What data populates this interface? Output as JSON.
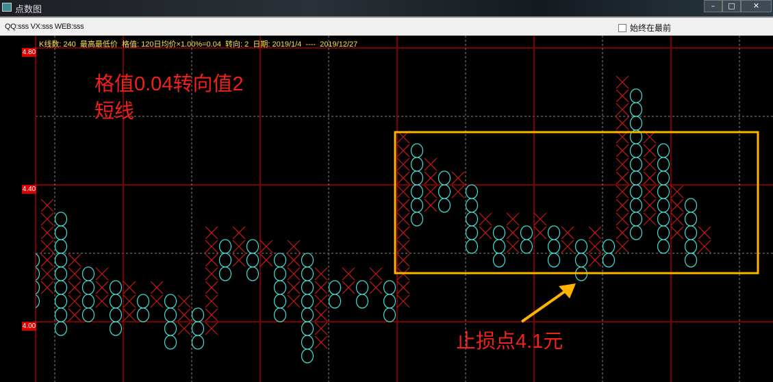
{
  "window": {
    "title": "点数图",
    "minimize": "–",
    "maximize": "□",
    "close": "✕"
  },
  "toolbar": {
    "contact": "QQ:sss VX:sss WEB:sss",
    "always_on_top_label": "始终在最前",
    "always_on_top_checked": false
  },
  "info_line": "K线数: 240  最高最低价  格值: 120日均价×1.00%=0.04  转向: 2  日期: 2019/1/4  ----  2019/12/27",
  "annotations": {
    "title_line1": "格值0.04转向值2",
    "title_line2": "短线",
    "stop_loss": "止损点4.1元"
  },
  "colors": {
    "x_mark": "#d01818",
    "o_mark": "#40e0d8",
    "grid_major": "#a00000",
    "grid_minor": "#888888",
    "highlight_box": "#ffb400",
    "annotation": "#f0201a"
  },
  "chart_data": {
    "type": "point-and-figure",
    "box_size": 0.04,
    "reversal": 2,
    "ylim": [
      3.84,
      4.8
    ],
    "y_ticks": [
      "4.80",
      "4.40",
      "4.00"
    ],
    "note": "each column: type, top box price, bottom box price",
    "columns": [
      {
        "t": "O",
        "hi": 4.2,
        "lo": 4.08
      },
      {
        "t": "X",
        "hi": 4.36,
        "lo": 4.12
      },
      {
        "t": "O",
        "hi": 4.32,
        "lo": 4.0
      },
      {
        "t": "X",
        "hi": 4.2,
        "lo": 4.04
      },
      {
        "t": "O",
        "hi": 4.16,
        "lo": 4.04
      },
      {
        "t": "X",
        "hi": 4.16,
        "lo": 4.08
      },
      {
        "t": "O",
        "hi": 4.12,
        "lo": 4.0
      },
      {
        "t": "X",
        "hi": 4.12,
        "lo": 4.04
      },
      {
        "t": "O",
        "hi": 4.08,
        "lo": 4.04
      },
      {
        "t": "X",
        "hi": 4.12,
        "lo": 4.08
      },
      {
        "t": "O",
        "hi": 4.08,
        "lo": 3.96
      },
      {
        "t": "X",
        "hi": 4.08,
        "lo": 4.0
      },
      {
        "t": "O",
        "hi": 4.04,
        "lo": 3.96
      },
      {
        "t": "X",
        "hi": 4.28,
        "lo": 4.0
      },
      {
        "t": "O",
        "hi": 4.24,
        "lo": 4.16
      },
      {
        "t": "X",
        "hi": 4.28,
        "lo": 4.2
      },
      {
        "t": "O",
        "hi": 4.24,
        "lo": 4.16
      },
      {
        "t": "X",
        "hi": 4.24,
        "lo": 4.2
      },
      {
        "t": "O",
        "hi": 4.2,
        "lo": 4.04
      },
      {
        "t": "X",
        "hi": 4.24,
        "lo": 4.08
      },
      {
        "t": "O",
        "hi": 4.2,
        "lo": 3.92
      },
      {
        "t": "X",
        "hi": 4.16,
        "lo": 3.96
      },
      {
        "t": "O",
        "hi": 4.12,
        "lo": 4.08
      },
      {
        "t": "X",
        "hi": 4.16,
        "lo": 4.12
      },
      {
        "t": "O",
        "hi": 4.12,
        "lo": 4.08
      },
      {
        "t": "X",
        "hi": 4.16,
        "lo": 4.12
      },
      {
        "t": "O",
        "hi": 4.12,
        "lo": 4.04
      },
      {
        "t": "X",
        "hi": 4.56,
        "lo": 4.08
      },
      {
        "t": "O",
        "hi": 4.52,
        "lo": 4.32
      },
      {
        "t": "X",
        "hi": 4.48,
        "lo": 4.36
      },
      {
        "t": "O",
        "hi": 4.44,
        "lo": 4.36
      },
      {
        "t": "X",
        "hi": 4.44,
        "lo": 4.4
      },
      {
        "t": "O",
        "hi": 4.4,
        "lo": 4.24
      },
      {
        "t": "X",
        "hi": 4.32,
        "lo": 4.28
      },
      {
        "t": "O",
        "hi": 4.28,
        "lo": 4.2
      },
      {
        "t": "X",
        "hi": 4.32,
        "lo": 4.24
      },
      {
        "t": "O",
        "hi": 4.28,
        "lo": 4.24
      },
      {
        "t": "X",
        "hi": 4.32,
        "lo": 4.28
      },
      {
        "t": "O",
        "hi": 4.28,
        "lo": 4.2
      },
      {
        "t": "X",
        "hi": 4.28,
        "lo": 4.24
      },
      {
        "t": "O",
        "hi": 4.24,
        "lo": 4.16
      },
      {
        "t": "X",
        "hi": 4.28,
        "lo": 4.2
      },
      {
        "t": "O",
        "hi": 4.24,
        "lo": 4.2
      },
      {
        "t": "X",
        "hi": 4.72,
        "lo": 4.24
      },
      {
        "t": "O",
        "hi": 4.68,
        "lo": 4.28
      },
      {
        "t": "X",
        "hi": 4.56,
        "lo": 4.32
      },
      {
        "t": "O",
        "hi": 4.52,
        "lo": 4.24
      },
      {
        "t": "X",
        "hi": 4.4,
        "lo": 4.28
      },
      {
        "t": "O",
        "hi": 4.36,
        "lo": 4.2
      },
      {
        "t": "X",
        "hi": 4.28,
        "lo": 4.24
      }
    ]
  }
}
